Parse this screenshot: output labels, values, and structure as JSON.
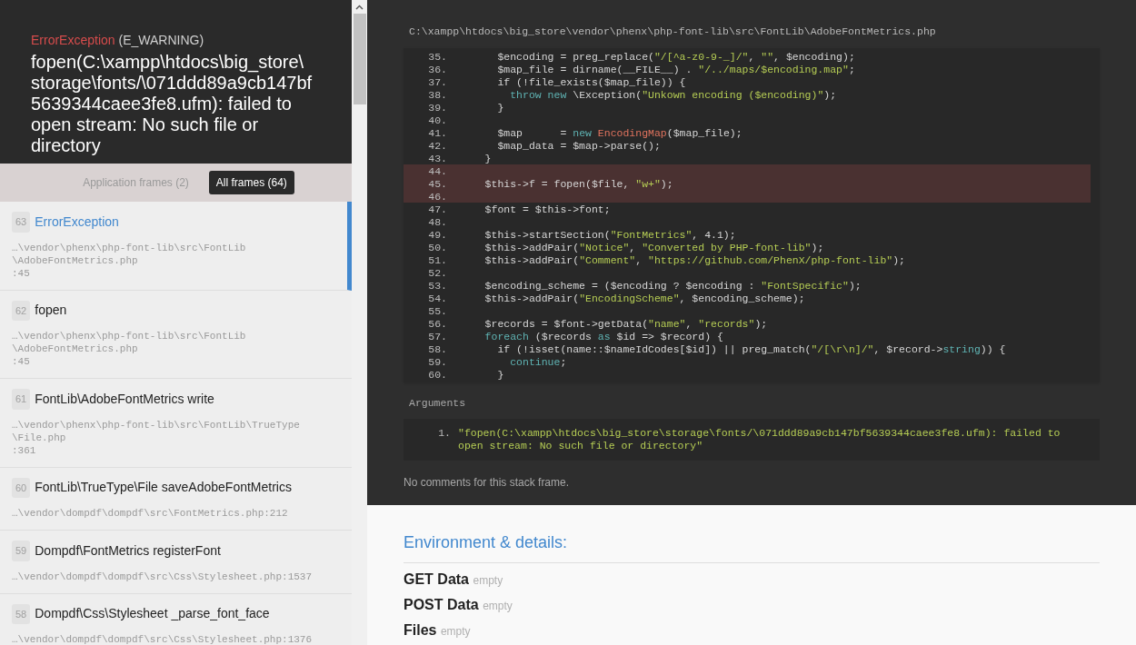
{
  "exception": {
    "class": "ErrorException",
    "code": "(E_WARNING)",
    "message": "fopen(C:\\xampp\\htdocs\\big_store\\storage\\fonts/\\071ddd89a9cb147bf5639344caee3fe8.ufm): failed to open stream: No such file or directory"
  },
  "frame_tabs": [
    {
      "label": "Application frames (2)",
      "selected": false
    },
    {
      "label": "All frames (64)",
      "selected": true
    }
  ],
  "frames": [
    {
      "number": "63",
      "title": "ErrorException",
      "file_lines": [
        "…\\vendor\\phenx\\php-font-lib\\src\\FontLib",
        "\\AdobeFontMetrics.php",
        ":45"
      ],
      "selected": true
    },
    {
      "number": "62",
      "title": "fopen",
      "file_lines": [
        "…\\vendor\\phenx\\php-font-lib\\src\\FontLib",
        "\\AdobeFontMetrics.php",
        ":45"
      ],
      "selected": false
    },
    {
      "number": "61",
      "title": "FontLib\\AdobeFontMetrics write",
      "file_lines": [
        "…\\vendor\\phenx\\php-font-lib\\src\\FontLib\\TrueType",
        "\\File.php",
        ":361"
      ],
      "selected": false
    },
    {
      "number": "60",
      "title": "FontLib\\TrueType\\File saveAdobeFontMetrics",
      "file_lines": [
        "…\\vendor\\dompdf\\dompdf\\src\\FontMetrics.php:212"
      ],
      "selected": false
    },
    {
      "number": "59",
      "title": "Dompdf\\FontMetrics registerFont",
      "file_lines": [
        "…\\vendor\\dompdf\\dompdf\\src\\Css\\Stylesheet.php:1537"
      ],
      "selected": false
    },
    {
      "number": "58",
      "title": "Dompdf\\Css\\Stylesheet _parse_font_face",
      "file_lines": [
        "…\\vendor\\dompdf\\dompdf\\src\\Css\\Stylesheet.php:1376"
      ],
      "selected": false
    }
  ],
  "code_view": {
    "file_path": "C:\\xampp\\htdocs\\big_store\\vendor\\phenx\\php-font-lib\\src\\FontLib\\AdobeFontMetrics.php",
    "lines": [
      {
        "number": "35.",
        "highlighted": false,
        "tokens": [
          {
            "kind": "plain",
            "text": "      $encoding = preg_replace("
          },
          {
            "kind": "string",
            "text": "\"/[^a-z0-9-_]/\""
          },
          {
            "kind": "plain",
            "text": ", "
          },
          {
            "kind": "string",
            "text": "\"\""
          },
          {
            "kind": "plain",
            "text": ", $encoding);"
          }
        ]
      },
      {
        "number": "36.",
        "highlighted": false,
        "tokens": [
          {
            "kind": "plain",
            "text": "      $map_file = dirname(__FILE__) . "
          },
          {
            "kind": "string",
            "text": "\"/../maps/$encoding.map\""
          },
          {
            "kind": "plain",
            "text": ";"
          }
        ]
      },
      {
        "number": "37.",
        "highlighted": false,
        "tokens": [
          {
            "kind": "plain",
            "text": "      if (!file_exists($map_file)) {"
          }
        ]
      },
      {
        "number": "38.",
        "highlighted": false,
        "tokens": [
          {
            "kind": "keyword",
            "text": "        throw new"
          },
          {
            "kind": "plain",
            "text": " \\Exception("
          },
          {
            "kind": "string",
            "text": "\"Unkown encoding ($encoding)\""
          },
          {
            "kind": "plain",
            "text": ");"
          }
        ]
      },
      {
        "number": "39.",
        "highlighted": false,
        "tokens": [
          {
            "kind": "plain",
            "text": "      }"
          }
        ]
      },
      {
        "number": "40.",
        "highlighted": false
      },
      {
        "number": "41.",
        "highlighted": false,
        "tokens": [
          {
            "kind": "plain",
            "text": "      $map      = "
          },
          {
            "kind": "keyword",
            "text": "new"
          },
          {
            "kind": "class",
            "text": " EncodingMap"
          },
          {
            "kind": "plain",
            "text": "($map_file);"
          }
        ]
      },
      {
        "number": "42.",
        "highlighted": false,
        "tokens": [
          {
            "kind": "plain",
            "text": "      $map_data = $map->parse();"
          }
        ]
      },
      {
        "number": "43.",
        "highlighted": false,
        "tokens": [
          {
            "kind": "plain",
            "text": "    }"
          }
        ]
      },
      {
        "number": "44.",
        "highlighted": true
      },
      {
        "number": "45.",
        "highlighted": true,
        "tokens": [
          {
            "kind": "plain",
            "text": "    $this->f = fopen($file, "
          },
          {
            "kind": "string",
            "text": "\"w+\""
          },
          {
            "kind": "plain",
            "text": ");"
          }
        ]
      },
      {
        "number": "46.",
        "highlighted": true
      },
      {
        "number": "47.",
        "highlighted": false,
        "tokens": [
          {
            "kind": "plain",
            "text": "    $font = $this->font;"
          }
        ]
      },
      {
        "number": "48.",
        "highlighted": false
      },
      {
        "number": "49.",
        "highlighted": false,
        "tokens": [
          {
            "kind": "plain",
            "text": "    $this->startSection("
          },
          {
            "kind": "string",
            "text": "\"FontMetrics\""
          },
          {
            "kind": "plain",
            "text": ", 4.1);"
          }
        ]
      },
      {
        "number": "50.",
        "highlighted": false,
        "tokens": [
          {
            "kind": "plain",
            "text": "    $this->addPair("
          },
          {
            "kind": "string",
            "text": "\"Notice\""
          },
          {
            "kind": "plain",
            "text": ", "
          },
          {
            "kind": "string",
            "text": "\"Converted by PHP-font-lib\""
          },
          {
            "kind": "plain",
            "text": ");"
          }
        ]
      },
      {
        "number": "51.",
        "highlighted": false,
        "tokens": [
          {
            "kind": "plain",
            "text": "    $this->addPair("
          },
          {
            "kind": "string",
            "text": "\"Comment\""
          },
          {
            "kind": "plain",
            "text": ", "
          },
          {
            "kind": "string",
            "text": "\"https://github.com/PhenX/php-font-lib\""
          },
          {
            "kind": "plain",
            "text": ");"
          }
        ]
      },
      {
        "number": "52.",
        "highlighted": false
      },
      {
        "number": "53.",
        "highlighted": false,
        "tokens": [
          {
            "kind": "plain",
            "text": "    $encoding_scheme = ($encoding ? $encoding : "
          },
          {
            "kind": "string",
            "text": "\"FontSpecific\""
          },
          {
            "kind": "plain",
            "text": ");"
          }
        ]
      },
      {
        "number": "54.",
        "highlighted": false,
        "tokens": [
          {
            "kind": "plain",
            "text": "    $this->addPair("
          },
          {
            "kind": "string",
            "text": "\"EncodingScheme\""
          },
          {
            "kind": "plain",
            "text": ", $encoding_scheme);"
          }
        ]
      },
      {
        "number": "55.",
        "highlighted": false
      },
      {
        "number": "56.",
        "highlighted": false,
        "tokens": [
          {
            "kind": "plain",
            "text": "    $records = $font->getData("
          },
          {
            "kind": "string",
            "text": "\"name\""
          },
          {
            "kind": "plain",
            "text": ", "
          },
          {
            "kind": "string",
            "text": "\"records\""
          },
          {
            "kind": "plain",
            "text": ");"
          }
        ]
      },
      {
        "number": "57.",
        "highlighted": false,
        "tokens": [
          {
            "kind": "keyword",
            "text": "    foreach"
          },
          {
            "kind": "plain",
            "text": " ($records "
          },
          {
            "kind": "keyword",
            "text": "as"
          },
          {
            "kind": "plain",
            "text": " $id => $record) {"
          }
        ]
      },
      {
        "number": "58.",
        "highlighted": false,
        "tokens": [
          {
            "kind": "plain",
            "text": "      if (!isset(name::$nameIdCodes[$id]) || preg_match("
          },
          {
            "kind": "string",
            "text": "\"/[\\r\\n]/\""
          },
          {
            "kind": "plain",
            "text": ", $record->"
          },
          {
            "kind": "keyword",
            "text": "string"
          },
          {
            "kind": "plain",
            "text": ")) {"
          }
        ]
      },
      {
        "number": "59.",
        "highlighted": false,
        "tokens": [
          {
            "kind": "keyword",
            "text": "        continue"
          },
          {
            "kind": "plain",
            "text": ";"
          }
        ]
      },
      {
        "number": "60.",
        "highlighted": false,
        "tokens": [
          {
            "kind": "plain",
            "text": "      }"
          }
        ]
      }
    ]
  },
  "arguments": {
    "label": "Arguments",
    "items": [
      {
        "number": "1.",
        "value": "\"fopen(C:\\xampp\\htdocs\\big_store\\storage\\fonts/\\071ddd89a9cb147bf5639344caee3fe8.ufm): failed to open stream: No such file or directory\""
      }
    ]
  },
  "comments_note": "No comments for this stack frame.",
  "details": {
    "heading": "Environment & details:",
    "sections": [
      {
        "name": "GET Data",
        "value": "empty"
      },
      {
        "name": "POST Data",
        "value": "empty"
      },
      {
        "name": "Files",
        "value": "empty"
      }
    ]
  }
}
